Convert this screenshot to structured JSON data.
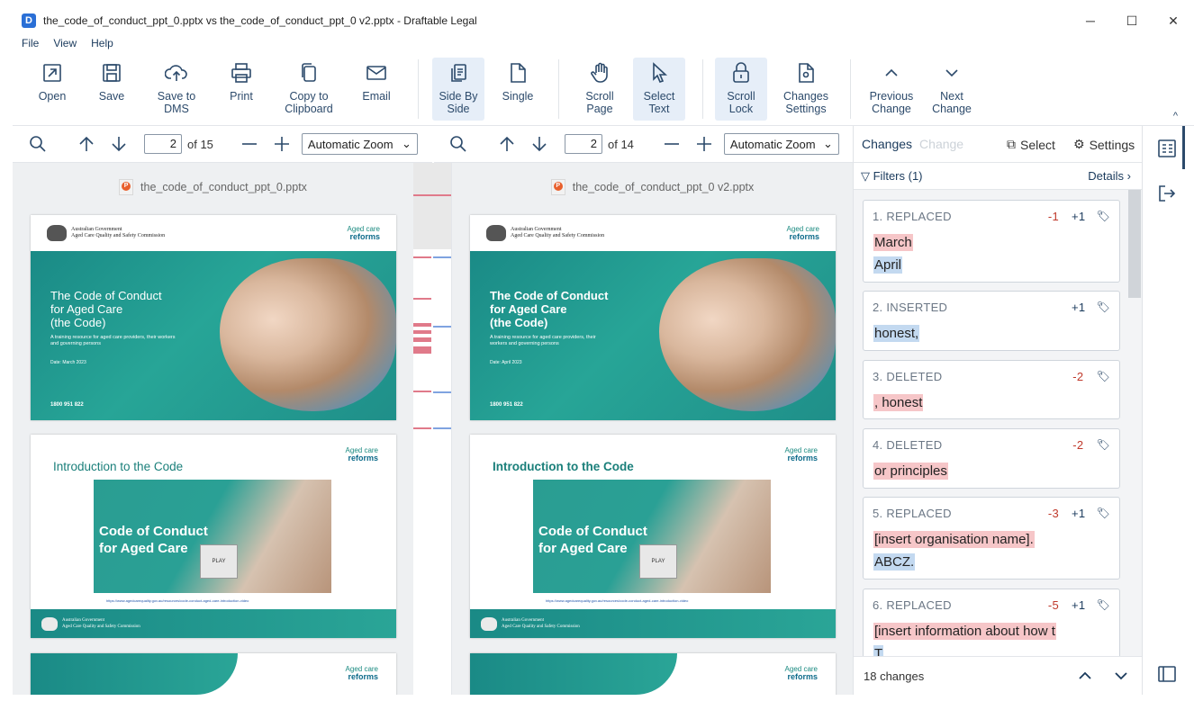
{
  "window": {
    "title": "the_code_of_conduct_ppt_0.pptx vs the_code_of_conduct_ppt_0 v2.pptx - Draftable Legal",
    "icon": "draftable-app-icon",
    "controls": {
      "minimize": "─",
      "maximize": "☐",
      "close": "✕"
    }
  },
  "menu": [
    "File",
    "View",
    "Help"
  ],
  "ribbon": {
    "open": "Open",
    "save": "Save",
    "save_dms": "Save to\nDMS",
    "print": "Print",
    "copy_clipboard": "Copy to\nClipboard",
    "email": "Email",
    "side_by_side": "Side By\nSide",
    "single": "Single",
    "scroll_page": "Scroll\nPage",
    "select_text": "Select\nText",
    "scroll_lock": "Scroll\nLock",
    "changes_settings": "Changes\nSettings",
    "previous_change": "Previous\nChange",
    "next_change": "Next\nChange",
    "collapse": "^"
  },
  "left_pane": {
    "page": "2",
    "of": "of 15",
    "zoom": "Automatic Zoom",
    "filename": "the_code_of_conduct_ppt_0.pptx"
  },
  "right_pane": {
    "page": "2",
    "of": "of 14",
    "zoom": "Automatic Zoom",
    "filename": "the_code_of_conduct_ppt_0 v2.pptx"
  },
  "slides": {
    "gov_line1": "Australian Government",
    "gov_line2": "Aged Care Quality and Safety Commission",
    "acr_top": "Aged care",
    "acr_bottom": "reforms",
    "left_title": "The Code of Conduct\nfor Aged Care\n(the Code)",
    "right_title": "The Code of Conduct\nfor Aged Care\n(the Code)",
    "left_sub": "A training resource for aged care providers, their workers and governing persons",
    "right_sub": "A training resource for aged care providers, their workers and governing persons",
    "left_date": "Date: March 2023",
    "right_date": "Date: April 2023",
    "phone": "1800 951 822",
    "intro_title": "Introduction to the Code",
    "video_title": "Code of Conduct\nfor Aged Care",
    "play": "PLAY",
    "left_link": "https://www.agedcarequality.gov.au/resources/code-conduct-aged-care-introduction-video",
    "right_link": "https://www.agedcarequality.gov.au/resources/code-conduct-aged-care-introduction-video"
  },
  "changes_panel": {
    "title": "Changes",
    "ghost_title": "Change",
    "select": "Select",
    "settings": "Settings",
    "filters": "Filters (1)",
    "details": "Details",
    "cards": [
      {
        "index_type": "1. REPLACED",
        "del_count": "-1",
        "ins_count": "+1",
        "deleted": "March",
        "inserted": "April"
      },
      {
        "index_type": "2. INSERTED",
        "del_count": "",
        "ins_count": "+1",
        "deleted": "",
        "inserted": "honest,"
      },
      {
        "index_type": "3. DELETED",
        "del_count": "-2",
        "ins_count": "",
        "deleted": ", honest",
        "inserted": ""
      },
      {
        "index_type": "4. DELETED",
        "del_count": "-2",
        "ins_count": "",
        "deleted": "or principles",
        "inserted": ""
      },
      {
        "index_type": "5. REPLACED",
        "del_count": "-3",
        "ins_count": "+1",
        "deleted": "[insert organisation name].",
        "inserted": "ABCZ."
      },
      {
        "index_type": "6. REPLACED",
        "del_count": "-5",
        "ins_count": "+1",
        "deleted": "[insert information about how t",
        "inserted": "T"
      }
    ],
    "footer_count": "18 changes"
  },
  "colors": {
    "accent": "#2c4a6b",
    "deleted_bg": "#f6c6c8",
    "inserted_bg": "#c3d9f0",
    "teal": "#1a8a86"
  }
}
